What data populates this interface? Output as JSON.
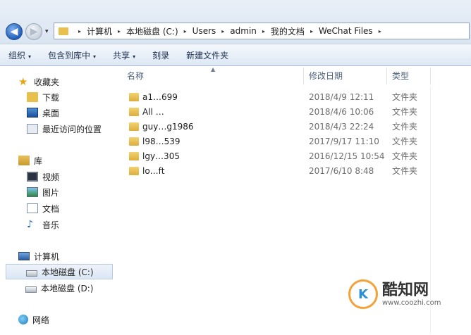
{
  "address": {
    "back_glyph": "◀",
    "forward_glyph": "▶",
    "history_glyph": "▾",
    "crumbs": [
      "计算机",
      "本地磁盘 (C:)",
      "Users",
      "admin",
      "我的文档",
      "WeChat Files"
    ],
    "separator": "▸"
  },
  "toolbar": {
    "organize": "组织",
    "include_in_library": "包含到库中",
    "share": "共享",
    "burn": "刻录",
    "new_folder": "新建文件夹",
    "caret": "▾"
  },
  "nav": {
    "favorites": "收藏夹",
    "downloads": "下载",
    "desktop": "桌面",
    "recent_places": "最近访问的位置",
    "libraries": "库",
    "videos": "视频",
    "pictures": "图片",
    "documents": "文档",
    "music": "音乐",
    "computer": "计算机",
    "local_disk_c": "本地磁盘 (C:)",
    "local_disk_d": "本地磁盘 (D:)",
    "network": "网络"
  },
  "columns": {
    "name": "名称",
    "date_modified": "修改日期",
    "type": "类型",
    "sort_arrow": "▲"
  },
  "files": [
    {
      "name": "a1…699",
      "date": "2018/4/9 12:11",
      "type": "文件夹"
    },
    {
      "name": "All …",
      "date": "2018/4/6 10:06",
      "type": "文件夹"
    },
    {
      "name": "guy…g1986",
      "date": "2018/4/3 22:24",
      "type": "文件夹"
    },
    {
      "name": "l98…539",
      "date": "2017/9/17 11:10",
      "type": "文件夹"
    },
    {
      "name": "lgy…305",
      "date": "2016/12/15 10:54",
      "type": "文件夹"
    },
    {
      "name": "lo…ft",
      "date": "2017/6/10 8:48",
      "type": "文件夹"
    }
  ],
  "watermark": {
    "logo_text": "K",
    "title": "酷知网",
    "url": "www.coozhi.com"
  }
}
